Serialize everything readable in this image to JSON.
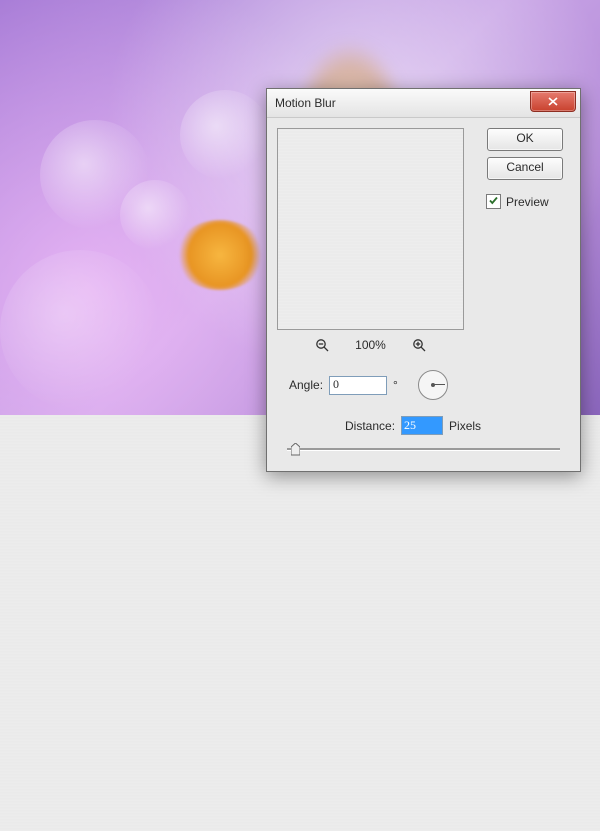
{
  "dialog": {
    "title": "Motion Blur",
    "ok_label": "OK",
    "cancel_label": "Cancel",
    "preview_label": "Preview",
    "preview_checked": true,
    "zoom_level": "100%",
    "angle_label": "Angle:",
    "angle_value": "0",
    "angle_unit": "°",
    "distance_label": "Distance:",
    "distance_value": "25",
    "distance_unit": "Pixels"
  },
  "icons": {
    "zoom_out": "zoom-out-icon",
    "zoom_in": "zoom-in-icon",
    "close": "close-icon",
    "check": "check-icon"
  }
}
